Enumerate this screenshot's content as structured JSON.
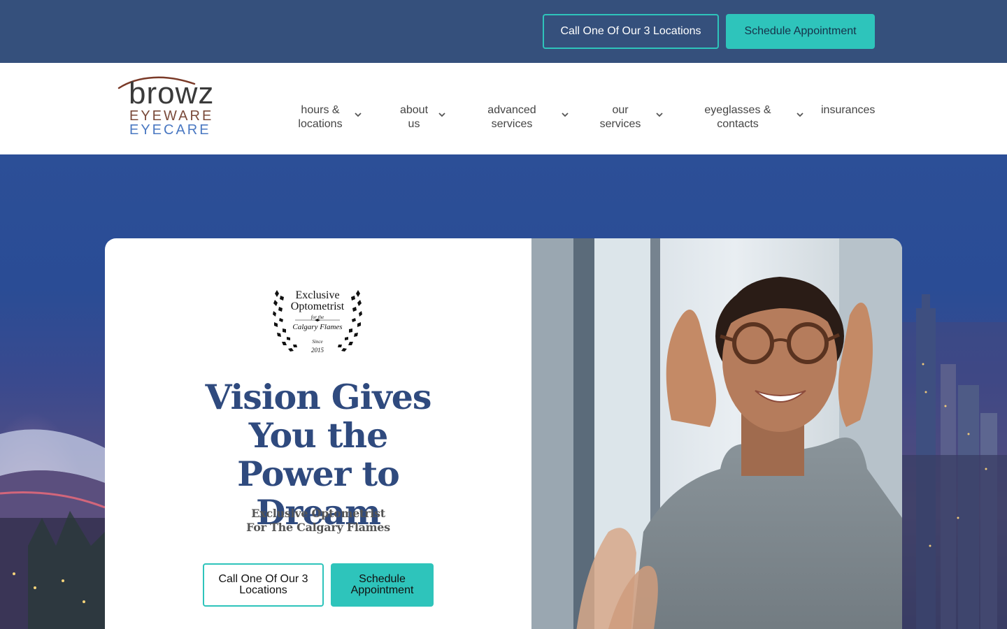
{
  "topbar": {
    "call_button": "Call One Of Our 3 Locations",
    "schedule_button": "Schedule Appointment"
  },
  "logo": {
    "line1": "browz",
    "line2": "EYEWARE",
    "line3": "EYECARE"
  },
  "nav": {
    "items": [
      {
        "label": "hours & locations",
        "has_dropdown": true
      },
      {
        "label": "about us",
        "has_dropdown": true
      },
      {
        "label": "advanced services",
        "has_dropdown": true
      },
      {
        "label": "our services",
        "has_dropdown": true
      },
      {
        "label": "eyeglasses & contacts",
        "has_dropdown": true
      },
      {
        "label": "insurances",
        "has_dropdown": false
      }
    ]
  },
  "hero": {
    "badge": {
      "line1": "Exclusive",
      "line2": "Optometrist",
      "line3": "for the",
      "line4": "Calgary Flames",
      "line5": "Since",
      "line6": "2015"
    },
    "headline": "Vision Gives You the Power to Dream",
    "subheadline_line1": "Exclusive Optometrist",
    "subheadline_line2": "For The Calgary Flames",
    "call_button": "Call One Of Our 3 Locations",
    "schedule_button": "Schedule Appointment"
  },
  "colors": {
    "topbar_bg": "#35507c",
    "accent_teal": "#2ec4bb",
    "headline_navy": "#2f4a7e",
    "hero_blue": "#2a4c95"
  }
}
